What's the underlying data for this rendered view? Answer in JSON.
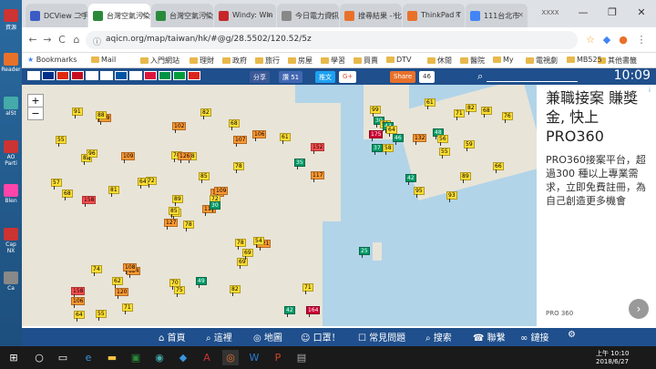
{
  "desktop": {
    "icons": [
      "資源",
      "Reader",
      "alSt",
      "AO Parti",
      "Blen",
      "Cap NX",
      "Ca"
    ]
  },
  "tabs": [
    {
      "label": "DCView 二手",
      "color": "#3b5cc4"
    },
    {
      "label": "台灣空氣污染",
      "color": "#2a8a3a",
      "active": true
    },
    {
      "label": "台灣空氣污染",
      "color": "#2a8a3a"
    },
    {
      "label": "Windy: Win",
      "color": "#c62828"
    },
    {
      "label": "今日電力資訊",
      "color": "#888"
    },
    {
      "label": "搜尋結果 - 比",
      "color": "#e8712a"
    },
    {
      "label": "ThinkPad T",
      "color": "#e8712a"
    },
    {
      "label": "111台北市",
      "color": "#4285f4"
    }
  ],
  "window": {
    "user_label": "XXXX",
    "minimize": "—",
    "maximize": "❐",
    "close": "✕"
  },
  "address": {
    "url": "aqicn.org/map/taiwan/hk/#@g/28.5502/120.52/5z",
    "back": "←",
    "forward": "→",
    "reload": "C",
    "home": "⌂"
  },
  "bookmarks": {
    "apps": "Bookmarks",
    "items": [
      "Mail",
      "入門網站",
      "理財",
      "政府",
      "旅行",
      "房屋",
      "學習",
      "買賣",
      "DTV",
      "休閒",
      "醫院",
      "My",
      "電視劇",
      "MB525"
    ],
    "other": "其他書籤"
  },
  "site": {
    "share": "分享",
    "like": "讚 51",
    "post": "推文",
    "gplus": "G+",
    "share2": "Share",
    "count": "46",
    "time": "10:09"
  },
  "flags": [
    "#fff",
    "#002e8a",
    "#de2910",
    "#c60b1e",
    "#fff",
    "#fff",
    "#0055a4",
    "#fff",
    "#dc143c",
    "#009246",
    "#009c3b",
    "#da251d"
  ],
  "map": {
    "zoom_in": "+",
    "zoom_out": "−"
  },
  "markers": [
    {
      "v": "78",
      "c": "#ffde33"
    },
    {
      "v": "82",
      "c": "#ffde33"
    },
    {
      "v": "99",
      "c": "#ffde33"
    },
    {
      "v": "158",
      "c": "#ff4e4e"
    },
    {
      "v": "104",
      "c": "#ff9933"
    },
    {
      "v": "124",
      "c": "#ff9933"
    },
    {
      "v": "68",
      "c": "#ffde33"
    },
    {
      "v": "78",
      "c": "#ffde33"
    },
    {
      "v": "107",
      "c": "#ff9933"
    },
    {
      "v": "117",
      "c": "#ff9933"
    },
    {
      "v": "129",
      "c": "#ff9933"
    },
    {
      "v": "164",
      "c": "#cc0033"
    },
    {
      "v": "158",
      "c": "#ff4e4e"
    },
    {
      "v": "152",
      "c": "#ff4e4e"
    },
    {
      "v": "127",
      "c": "#ff9933"
    },
    {
      "v": "78",
      "c": "#ffde33"
    },
    {
      "v": "55",
      "c": "#ffde33"
    },
    {
      "v": "78",
      "c": "#ffde33"
    },
    {
      "v": "85",
      "c": "#ffde33"
    },
    {
      "v": "74",
      "c": "#ffde33"
    },
    {
      "v": "72",
      "c": "#ffde33"
    },
    {
      "v": "106",
      "c": "#ff9933"
    },
    {
      "v": "120",
      "c": "#ff9933"
    },
    {
      "v": "126",
      "c": "#ff9933"
    },
    {
      "v": "109",
      "c": "#ff9933"
    },
    {
      "v": "121",
      "c": "#ff9933"
    },
    {
      "v": "96",
      "c": "#ffde33"
    },
    {
      "v": "102",
      "c": "#ff9933"
    },
    {
      "v": "68",
      "c": "#ffde33"
    },
    {
      "v": "78",
      "c": "#ffde33"
    },
    {
      "v": "117",
      "c": "#ff9933"
    },
    {
      "v": "85",
      "c": "#ffde33"
    },
    {
      "v": "70",
      "c": "#ffde33"
    },
    {
      "v": "89",
      "c": "#ffde33"
    },
    {
      "v": "109",
      "c": "#ff9933"
    },
    {
      "v": "106",
      "c": "#ff9933"
    },
    {
      "v": "108",
      "c": "#ff9933"
    },
    {
      "v": "42",
      "c": "#009966"
    },
    {
      "v": "71",
      "c": "#ffde33"
    },
    {
      "v": "54",
      "c": "#ffde33"
    },
    {
      "v": "82",
      "c": "#ffde33"
    },
    {
      "v": "64",
      "c": "#ffde33"
    },
    {
      "v": "81",
      "c": "#ffde33"
    },
    {
      "v": "69",
      "c": "#ffde33"
    },
    {
      "v": "71",
      "c": "#ffde33"
    },
    {
      "v": "57",
      "c": "#ffde33"
    },
    {
      "v": "72",
      "c": "#ffde33"
    },
    {
      "v": "64",
      "c": "#ffde33"
    },
    {
      "v": "75",
      "c": "#ffde33"
    },
    {
      "v": "30",
      "c": "#009966"
    },
    {
      "v": "25",
      "c": "#009966"
    },
    {
      "v": "35",
      "c": "#009966"
    },
    {
      "v": "55",
      "c": "#ffde33"
    },
    {
      "v": "69",
      "c": "#ffde33"
    },
    {
      "v": "82",
      "c": "#ffde33"
    },
    {
      "v": "62",
      "c": "#ffde33"
    },
    {
      "v": "88",
      "c": "#ffde33"
    },
    {
      "v": "91",
      "c": "#ffde33"
    },
    {
      "v": "49",
      "c": "#009966"
    },
    {
      "v": "61",
      "c": "#ffde33"
    },
    {
      "v": "82",
      "c": "#ffde33"
    },
    {
      "v": "55",
      "c": "#ffde33"
    },
    {
      "v": "132",
      "c": "#ff9933"
    },
    {
      "v": "48",
      "c": "#009966"
    },
    {
      "v": "76",
      "c": "#ffde33"
    },
    {
      "v": "61",
      "c": "#ffde33"
    },
    {
      "v": "68",
      "c": "#ffde33"
    },
    {
      "v": "71",
      "c": "#ffde33"
    },
    {
      "v": "59",
      "c": "#ffde33"
    },
    {
      "v": "42",
      "c": "#009966"
    },
    {
      "v": "89",
      "c": "#ffde33"
    },
    {
      "v": "93",
      "c": "#ffde33"
    },
    {
      "v": "66",
      "c": "#ffde33"
    },
    {
      "v": "56",
      "c": "#ffde33"
    },
    {
      "v": "95",
      "c": "#ffde33"
    },
    {
      "v": "99",
      "c": "#ffde33"
    },
    {
      "v": "30",
      "c": "#009966"
    },
    {
      "v": "175",
      "c": "#cc0033"
    },
    {
      "v": "51",
      "c": "#ffde33"
    },
    {
      "v": "58",
      "c": "#ffde33"
    },
    {
      "v": "43",
      "c": "#009966"
    },
    {
      "v": "37",
      "c": "#009966"
    },
    {
      "v": "64",
      "c": "#ffde33"
    },
    {
      "v": "46",
      "c": "#009966"
    }
  ],
  "ad": {
    "headline": "兼職接案 賺獎金, 快上 PRO360",
    "body": "PRO360接案平台，超過300 種以上專業需求，立即免費註冊，為自己創造更多機會",
    "source": "PRO 360",
    "chevron": "›",
    "ad_icon": "i"
  },
  "bottom_nav": [
    "首頁",
    "這裡",
    "地圖",
    "口罩！",
    "常見問題",
    "搜索",
    "聯繫",
    "鏈接"
  ],
  "taskbar": {
    "time": "上午 10:10",
    "date": "2018/6/27"
  }
}
